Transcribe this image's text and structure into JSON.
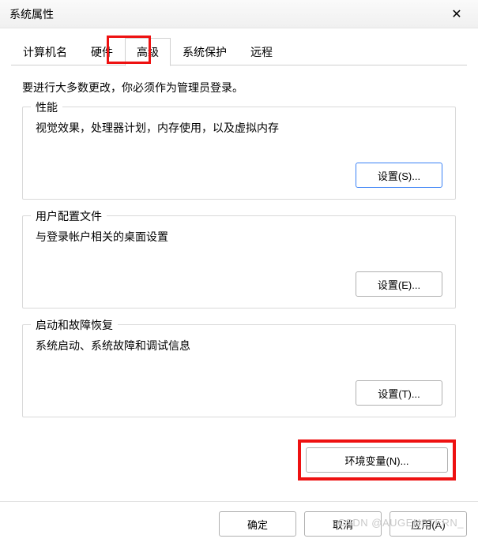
{
  "window": {
    "title": "系统属性",
    "close_symbol": "✕"
  },
  "tabs": {
    "items": [
      {
        "label": "计算机名"
      },
      {
        "label": "硬件"
      },
      {
        "label": "高级"
      },
      {
        "label": "系统保护"
      },
      {
        "label": "远程"
      }
    ],
    "active_index": 2
  },
  "intro": "要进行大多数更改，你必须作为管理员登录。",
  "sections": {
    "performance": {
      "legend": "性能",
      "desc": "视觉效果，处理器计划，内存使用，以及虚拟内存",
      "button": "设置(S)..."
    },
    "user_profiles": {
      "legend": "用户配置文件",
      "desc": "与登录帐户相关的桌面设置",
      "button": "设置(E)..."
    },
    "startup_recovery": {
      "legend": "启动和故障恢复",
      "desc": "系统启动、系统故障和调试信息",
      "button": "设置(T)..."
    }
  },
  "env_button": "环境变量(N)...",
  "footer": {
    "ok": "确定",
    "cancel": "取消",
    "apply": "应用(A)"
  },
  "watermark": "CSDN @AUGENSTERN_"
}
